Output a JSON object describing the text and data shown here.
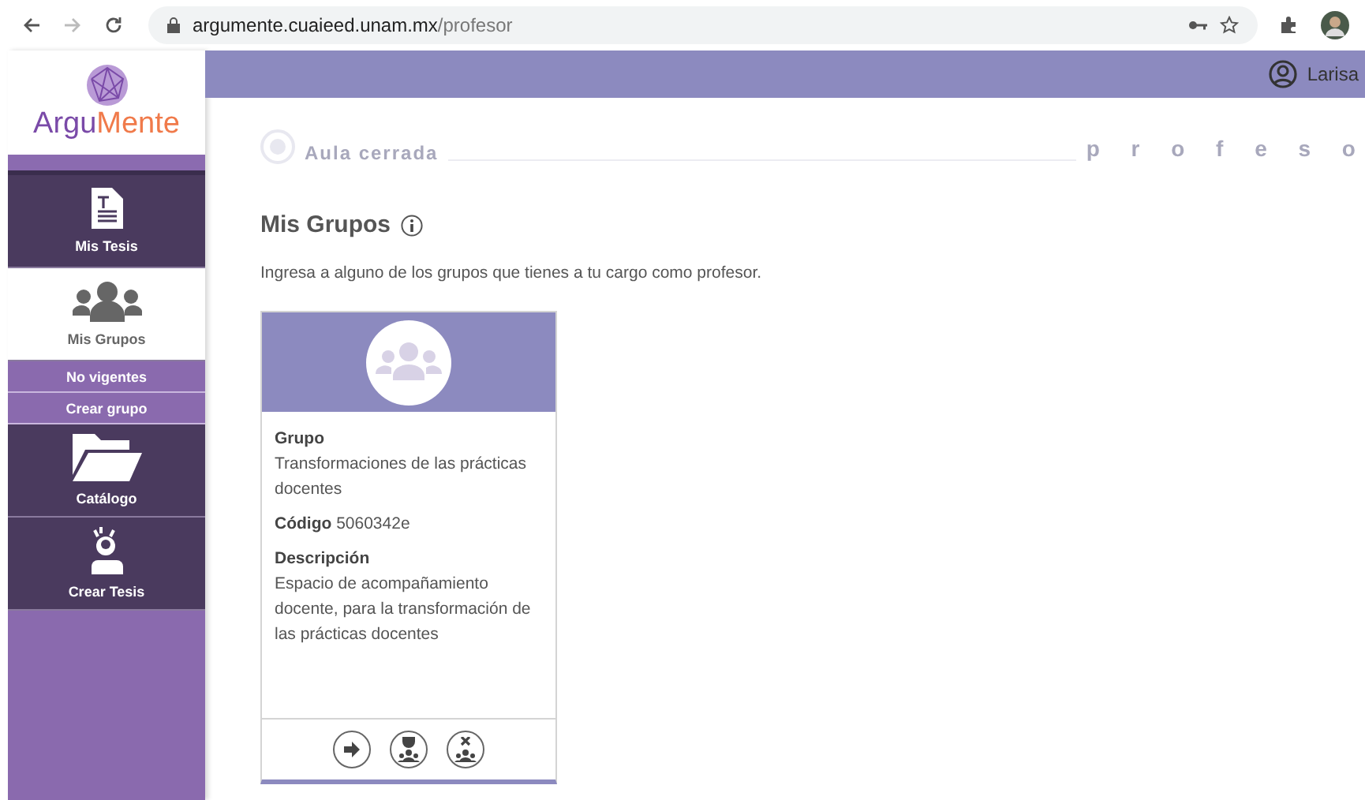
{
  "browser": {
    "url_host": "argumente.cuaieed.unam.mx",
    "url_path": "/profesor"
  },
  "logo": {
    "part1": "Argu",
    "part2": "Mente"
  },
  "user": {
    "name": "Larisa"
  },
  "sidebar": {
    "items": [
      {
        "label": "Mis Tesis",
        "kind": "document",
        "selected": false
      },
      {
        "label": "Mis Grupos",
        "kind": "group",
        "selected": true
      },
      {
        "label": "No vigentes",
        "kind": "sub",
        "selected": false
      },
      {
        "label": "Crear grupo",
        "kind": "sub",
        "selected": false
      },
      {
        "label": "Catálogo",
        "kind": "folder",
        "selected": false
      },
      {
        "label": "Crear Tesis",
        "kind": "idea",
        "selected": false
      }
    ]
  },
  "banner": {
    "status": "Aula cerrada",
    "role": "p r o f e s o"
  },
  "page": {
    "title": "Mis Grupos",
    "subtitle": "Ingresa a alguno de los grupos que tienes a tu cargo como profesor."
  },
  "cards": [
    {
      "group_label": "Grupo",
      "group": "Transformaciones de las prácticas docentes",
      "code_label": "Código",
      "code": "5060342e",
      "description_label": "Descripción",
      "description": "Espacio de acompañamiento docente, para la transformación de las prácticas docentes"
    }
  ]
}
